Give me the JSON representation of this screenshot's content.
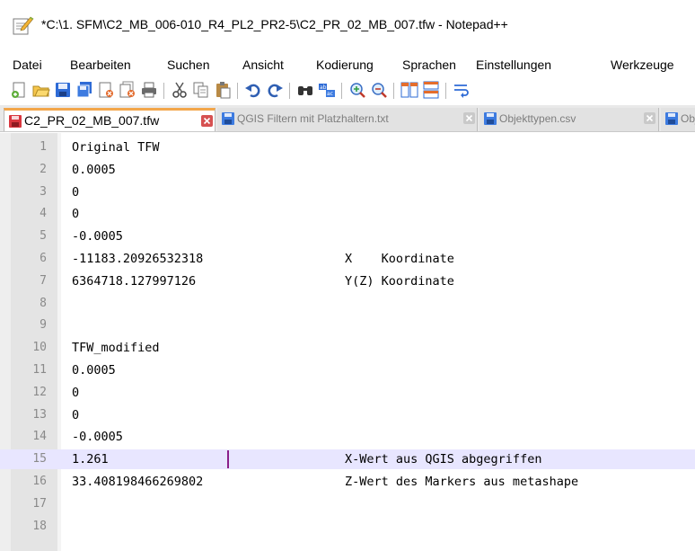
{
  "window": {
    "title": "*C:\\1. SFM\\C2_MB_006-010_R4_PL2_PR2-5\\C2_PR_02_MB_007.tfw - Notepad++"
  },
  "menu": [
    {
      "label": "Datei"
    },
    {
      "label": "Bearbeiten"
    },
    {
      "label": "Suchen"
    },
    {
      "label": "Ansicht"
    },
    {
      "label": "Kodierung"
    },
    {
      "label": "Sprachen"
    },
    {
      "label": "Einstellungen"
    },
    {
      "label": "Werkzeuge"
    }
  ],
  "toolbar": [
    "new-file-icon",
    "open-file-icon",
    "save-icon",
    "save-all-icon",
    "close-icon",
    "close-all-icon",
    "print-icon",
    "cut-icon",
    "copy-icon",
    "paste-icon",
    "undo-icon",
    "redo-icon",
    "find-icon",
    "replace-icon",
    "zoom-in-icon",
    "zoom-out-icon",
    "sync-vertical-icon",
    "sync-horizontal-icon",
    "word-wrap-icon"
  ],
  "tabs": [
    {
      "label": "C2_PR_02_MB_007.tfw",
      "active": true,
      "modified": true
    },
    {
      "label": "QGIS Filtern mit Platzhaltern.txt",
      "active": false
    },
    {
      "label": "Objekttypen.csv",
      "active": false
    },
    {
      "label": "Obje",
      "active": false
    }
  ],
  "editor": {
    "current_line": 15,
    "lines": [
      {
        "n": "1",
        "text": "Original TFW",
        "comment": ""
      },
      {
        "n": "2",
        "text": "0.0005",
        "comment": ""
      },
      {
        "n": "3",
        "text": "0",
        "comment": ""
      },
      {
        "n": "4",
        "text": "0",
        "comment": ""
      },
      {
        "n": "5",
        "text": "-0.0005",
        "comment": ""
      },
      {
        "n": "6",
        "text": "-11183.20926532318",
        "comment": "X    Koordinate"
      },
      {
        "n": "7",
        "text": "6364718.127997126",
        "comment": "Y(Z) Koordinate"
      },
      {
        "n": "8",
        "text": "",
        "comment": ""
      },
      {
        "n": "9",
        "text": "",
        "comment": ""
      },
      {
        "n": "10",
        "text": "TFW_modified",
        "comment": ""
      },
      {
        "n": "11",
        "text": "0.0005",
        "comment": ""
      },
      {
        "n": "12",
        "text": "0",
        "comment": ""
      },
      {
        "n": "13",
        "text": "0",
        "comment": ""
      },
      {
        "n": "14",
        "text": "-0.0005",
        "comment": ""
      },
      {
        "n": "15",
        "text": "1.261",
        "comment": "X-Wert aus QGIS abgegriffen"
      },
      {
        "n": "16",
        "text": "33.408198466269802",
        "comment": "Z-Wert des Markers aus metashape"
      },
      {
        "n": "17",
        "text": "",
        "comment": ""
      },
      {
        "n": "18",
        "text": "",
        "comment": ""
      }
    ]
  }
}
